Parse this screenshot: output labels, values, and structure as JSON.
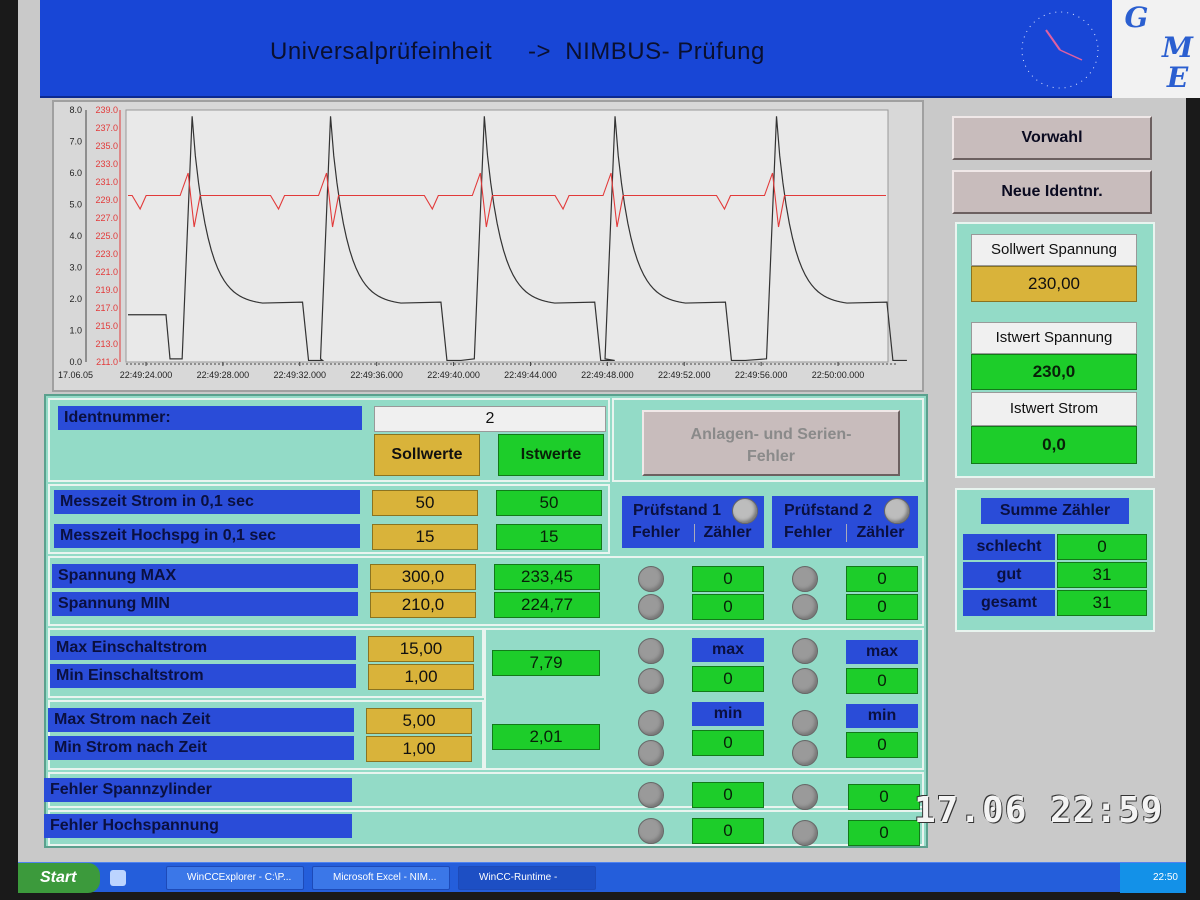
{
  "header": {
    "title": "Universalprüfeinheit     ->  NIMBUS- Prüfung",
    "logo_letters": [
      "G",
      "M",
      "E"
    ]
  },
  "chart_data": {
    "type": "line",
    "x": [
      "22:49:24.000",
      "22:49:28.000",
      "22:49:32.000",
      "22:49:36.000",
      "22:49:40.000",
      "22:49:44.000",
      "22:49:48.000",
      "22:49:52.000",
      "22:49:56.000",
      "22:50:00.000"
    ],
    "x_start_label": "17.06.05",
    "y_left_ticks": [
      "0.0",
      "1.0",
      "2.0",
      "3.0",
      "4.0",
      "5.0",
      "6.0",
      "7.0",
      "8.0"
    ],
    "y_right_ticks": [
      "211.0",
      "213.0",
      "215.0",
      "217.0",
      "219.0",
      "221.0",
      "223.0",
      "225.0",
      "227.0",
      "229.0",
      "231.0",
      "233.0",
      "235.0",
      "237.0",
      "239.0"
    ],
    "ylim_left": [
      0,
      8
    ],
    "ylim_right": [
      211,
      239
    ],
    "series": [
      {
        "color": "#333333",
        "axis": "left"
      },
      {
        "color": "#e23a3a",
        "axis": "right"
      }
    ]
  },
  "ident": {
    "label": "Identnummer:",
    "value": "2"
  },
  "headers": {
    "sollwerte": "Sollwerte",
    "istwerte": "Istwerte"
  },
  "fault_button": "Anlagen- und Serien-\nFehler",
  "pruefstand1": {
    "title": "Prüfstand 1",
    "fehler": "Fehler",
    "zaehler": "Zähler"
  },
  "pruefstand2": {
    "title": "Prüfstand 2",
    "fehler": "Fehler",
    "zaehler": "Zähler"
  },
  "rows": {
    "messzeit_strom": {
      "label": "Messzeit Strom in 0,1 sec",
      "soll": "50",
      "ist": "50"
    },
    "messzeit_hochspg": {
      "label": "Messzeit Hochspg in 0,1 sec",
      "soll": "15",
      "ist": "15"
    },
    "spannung_max": {
      "label": "Spannung MAX",
      "soll": "300,0",
      "ist": "233,45",
      "z1": "0",
      "z2": "0"
    },
    "spannung_min": {
      "label": "Spannung MIN",
      "soll": "210,0",
      "ist": "224,77",
      "z1": "0",
      "z2": "0"
    },
    "max_einschalt": {
      "label": "Max Einschaltstrom",
      "soll": "15,00",
      "z1": "max",
      "z2": "max"
    },
    "min_einschalt": {
      "label": "Min Einschaltstrom",
      "soll": "1,00",
      "z1": "0",
      "z2": "0"
    },
    "einschalt_ist": "7,79",
    "max_strom_zeit": {
      "label": "Max Strom nach Zeit",
      "soll": "5,00",
      "z1": "min",
      "z2": "min"
    },
    "min_strom_zeit": {
      "label": "Min Strom nach Zeit",
      "soll": "1,00",
      "z1": "0",
      "z2": "0"
    },
    "strom_zeit_ist": "2,01",
    "fehler_spannzylinder": {
      "label": "Fehler  Spannzylinder",
      "z1": "0",
      "z2": "0"
    },
    "fehler_hochspannung": {
      "label": "Fehler Hochspannung",
      "z1": "0",
      "z2": "0"
    }
  },
  "right": {
    "vorwahl": "Vorwahl",
    "neue_ident": "Neue Identnr.",
    "sollwert_spannung_label": "Sollwert Spannung",
    "sollwert_spannung": "230,00",
    "istwert_spannung_label": "Istwert Spannung",
    "istwert_spannung": "230,0",
    "istwert_strom_label": "Istwert Strom",
    "istwert_strom": "0,0"
  },
  "summe": {
    "title": "Summe Zähler",
    "schlecht_label": "schlecht",
    "schlecht": "0",
    "gut_label": "gut",
    "gut": "31",
    "gesamt_label": "gesamt",
    "gesamt": "31"
  },
  "taskbar": {
    "start": "Start",
    "tasks": [
      "WinCCExplorer - C:\\P...",
      "Microsoft Excel - NIM...",
      "WinCC-Runtime -"
    ],
    "clock": "22:50"
  },
  "osd": "17.06 22:59"
}
